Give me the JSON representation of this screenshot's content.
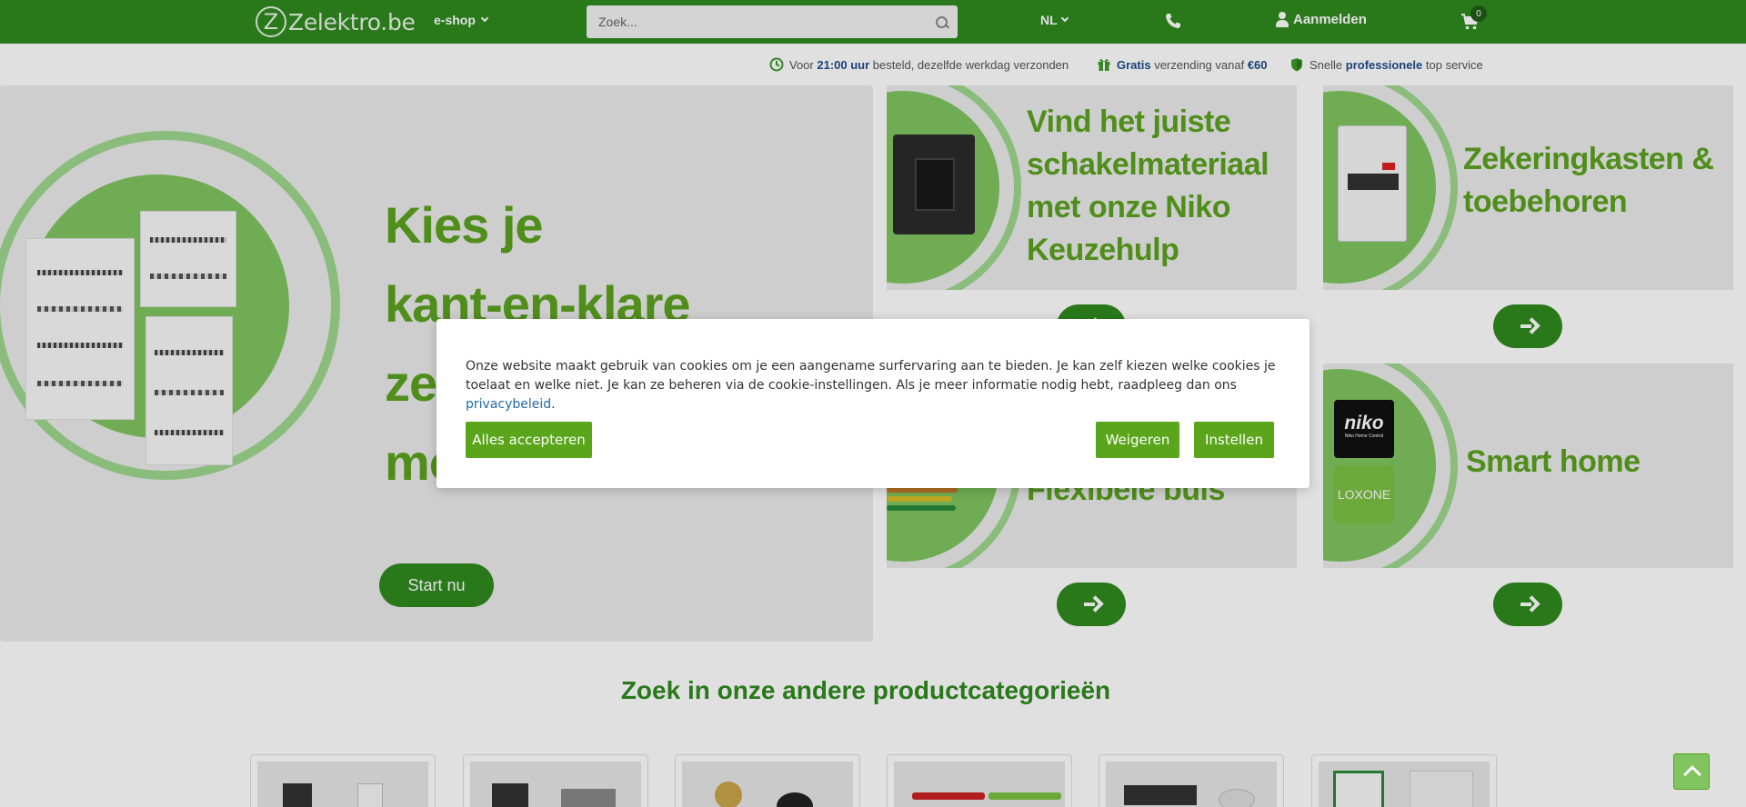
{
  "header": {
    "logo_letter": "Z",
    "logo_text": "Zelektro.be",
    "eshop_label": "e-shop",
    "search_placeholder": "Zoek...",
    "language": "NL",
    "login_label": "Aanmelden",
    "cart_count": "0"
  },
  "usp": [
    {
      "pre": "Voor ",
      "bold": "21:00 uur",
      "post": " besteld, dezelfde werkdag verzonden",
      "icon": "clock-icon"
    },
    {
      "pre": "",
      "bold": "Gratis",
      "post": " verzending vanaf ",
      "bold2": "€60",
      "icon": "gift-icon"
    },
    {
      "pre": "Snelle ",
      "bold": "professionele",
      "post": " top service",
      "icon": "shield-icon"
    }
  ],
  "hero": {
    "title_lines": [
      "Kies je",
      "kant-en-klare",
      "ze",
      "mo"
    ],
    "button_label": "Start nu"
  },
  "tiles": [
    {
      "title": "Vind het juiste schakelmateriaal met onze Niko Keuzehulp"
    },
    {
      "title": "Zekeringkasten & toebehoren"
    },
    {
      "title": "Flexibele buis"
    },
    {
      "title": "Smart home",
      "brands": [
        "niko",
        "Niko Home Control",
        "LOXONE"
      ]
    }
  ],
  "categories": {
    "heading": "Zoek in onze andere productcategorieën"
  },
  "cookie": {
    "text": "Onze website maakt gebruik van cookies om je een aangename surfervaring aan te bieden. Je kan zelf kiezen welke cookies je toelaat en welke niet. Je kan ze beheren via de cookie-instellingen. Als je meer informatie nodig hebt, raadpleeg dan ons ",
    "link_label": "privacybeleid",
    "suffix": ".",
    "accept_label": "Alles accepteren",
    "decline_label": "Weigeren",
    "settings_label": "Instellen"
  },
  "colors": {
    "brand_green": "#2f8a1f",
    "accent_green": "#5aa519",
    "headline_green": "#5aa21e"
  }
}
